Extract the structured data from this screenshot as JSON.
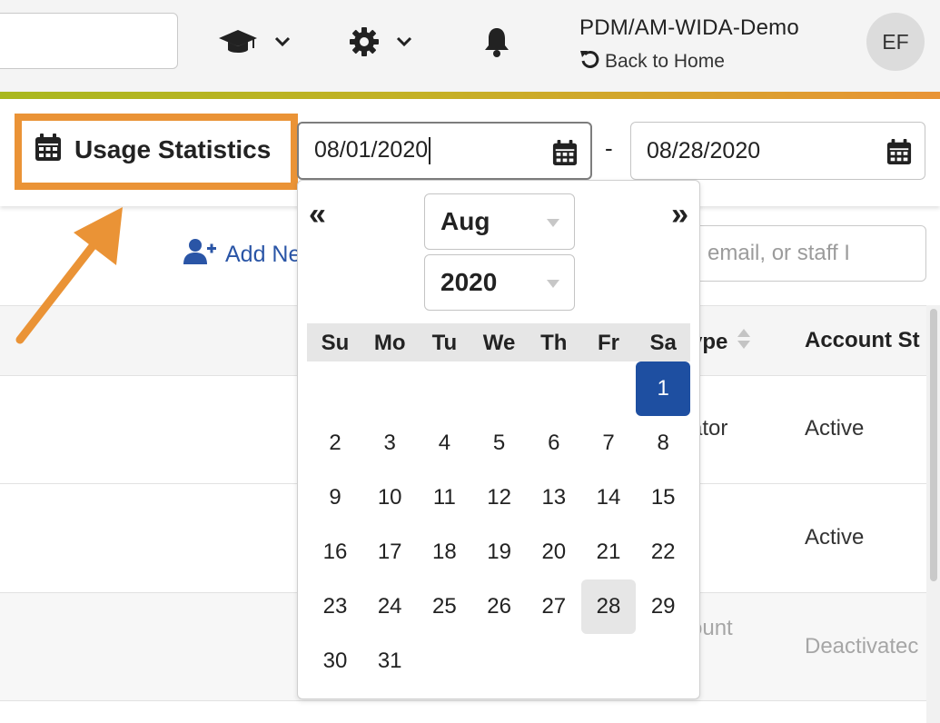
{
  "header": {
    "account_name": "PDM/AM-WIDA-Demo",
    "back_home_label": "Back to Home",
    "avatar_initials": "EF",
    "icons": [
      "graduation-cap-icon",
      "gear-icon",
      "bell-icon",
      "chevron-down-icon",
      "undo-icon"
    ]
  },
  "toolbar": {
    "usage_statistics_label": "Usage Statistics",
    "start_date": "08/01/2020",
    "date_separator": "-",
    "end_date": "08/28/2020"
  },
  "page": {
    "add_new_label": "Add Ne",
    "search_placeholder": "email, or staff I"
  },
  "table": {
    "headers": [
      "ype",
      "Account St"
    ],
    "rows": [
      {
        "type": "ator",
        "status": "Active",
        "muted": false
      },
      {
        "type": "",
        "status": "Active",
        "muted": false
      },
      {
        "type": "ount",
        "status": "Deactivatec",
        "muted": true
      }
    ]
  },
  "datepicker": {
    "prev_label": "«",
    "next_label": "»",
    "month": "Aug",
    "year": "2020",
    "weekdays": [
      "Su",
      "Mo",
      "Tu",
      "We",
      "Th",
      "Fr",
      "Sa"
    ],
    "weeks": [
      [
        "",
        "",
        "",
        "",
        "",
        "",
        "1"
      ],
      [
        "2",
        "3",
        "4",
        "5",
        "6",
        "7",
        "8"
      ],
      [
        "9",
        "10",
        "11",
        "12",
        "13",
        "14",
        "15"
      ],
      [
        "16",
        "17",
        "18",
        "19",
        "20",
        "21",
        "22"
      ],
      [
        "23",
        "24",
        "25",
        "26",
        "27",
        "28",
        "29"
      ],
      [
        "30",
        "31",
        "",
        "",
        "",
        "",
        ""
      ]
    ],
    "selected_day": "1",
    "range_end_day": "28"
  },
  "colors": {
    "highlight_border": "#ea9336",
    "selected_day": "#1e4fa1",
    "link": "#2a55a6",
    "stripe_start": "#a9b81f",
    "stripe_end": "#e99436"
  }
}
